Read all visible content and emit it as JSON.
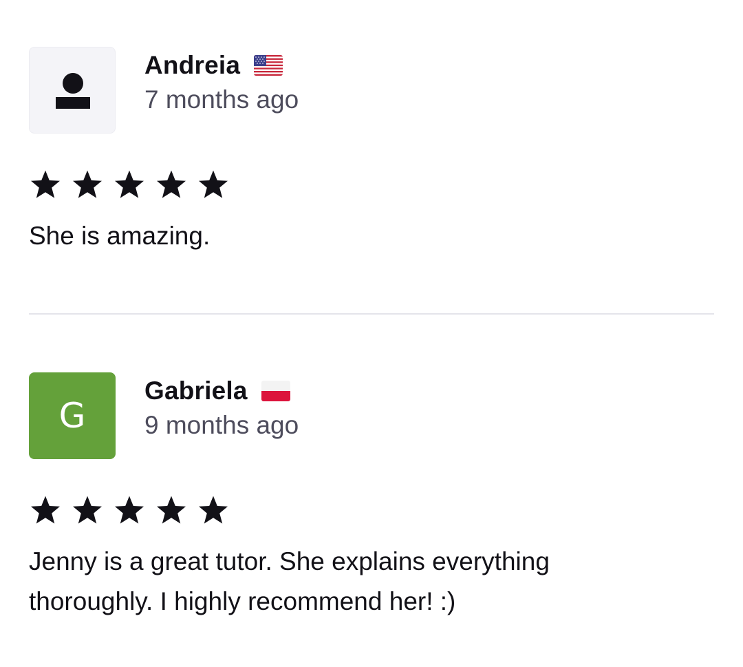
{
  "reviews": [
    {
      "name": "Andreia",
      "flag": "us-flag-icon",
      "date": "7 months ago",
      "avatar": {
        "type": "placeholder",
        "icon": "user-silhouette-icon"
      },
      "rating": 5,
      "text": "She is amazing."
    },
    {
      "name": "Gabriela",
      "flag": "poland-flag-icon",
      "date": "9 months ago",
      "avatar": {
        "type": "initial",
        "initial": "G",
        "color": "#64a13a"
      },
      "rating": 5,
      "text": "Jenny is a great tutor. She explains everything thoroughly. I highly recommend her! :)"
    }
  ],
  "colors": {
    "text": "#121117",
    "muted": "#4d4c5c",
    "divider": "#e4e4ea",
    "star": "#121117"
  }
}
